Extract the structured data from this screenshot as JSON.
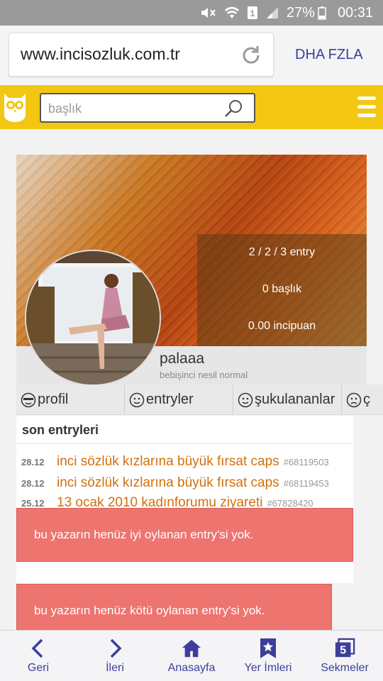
{
  "status_bar": {
    "battery": "27%",
    "time": "00:31",
    "sim": "1"
  },
  "browser": {
    "url": "www.incisozluk.com.tr",
    "more_label": "DHA FZLA"
  },
  "header": {
    "search_placeholder": "başlık"
  },
  "profile": {
    "stats": [
      "2 / 2 / 3 entry",
      "0 başlık",
      "0.00 incipuan"
    ],
    "username": "palaaa",
    "level": "bebişinci nesil normal"
  },
  "tabs": [
    {
      "label": "profil",
      "icon": "cool-face-icon"
    },
    {
      "label": "entryler",
      "icon": "smile-face-icon"
    },
    {
      "label": "şukulananlar",
      "icon": "smile-face-icon"
    },
    {
      "label": "ç",
      "icon": "sad-face-icon"
    }
  ],
  "entries": {
    "heading": "son entryleri",
    "items": [
      {
        "date": "28.12",
        "title": "inci sözlük kızlarına büyük fırsat caps",
        "id": "#68119503"
      },
      {
        "date": "28.12",
        "title": "inci sözlük kızlarına büyük fırsat caps",
        "id": "#68119453"
      },
      {
        "date": "25.12",
        "title": "13 ocak 2010 kadınforumu ziyareti",
        "id": "#67828420"
      }
    ]
  },
  "notices": {
    "good": "bu yazarın henüz iyi oylanan entry'si yok.",
    "bad": "bu yazarın henüz kötü oylanan entry'si yok."
  },
  "bottom_nav": [
    {
      "label": "Geri",
      "icon": "back-icon"
    },
    {
      "label": "İleri",
      "icon": "forward-icon"
    },
    {
      "label": "Anasayfa",
      "icon": "home-icon"
    },
    {
      "label": "Yer İmleri",
      "icon": "bookmark-icon"
    },
    {
      "label": "Sekmeler",
      "icon": "tabs-icon",
      "count": "5"
    }
  ],
  "colors": {
    "header": "#f3c711",
    "accent": "#3c3f9a",
    "entry_link": "#d2700c",
    "notice": "#ee7470"
  }
}
